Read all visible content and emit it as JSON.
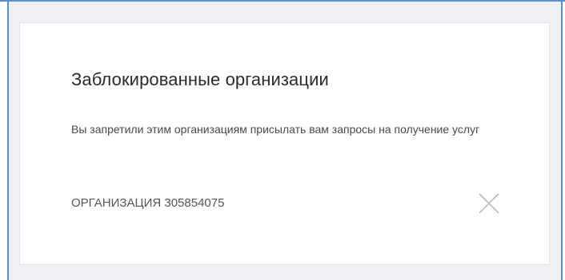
{
  "dialog": {
    "title": "Заблокированные организации",
    "description": "Вы запретили этим организациям присылать вам запросы на получение услуг"
  },
  "blocked_organizations": [
    {
      "name": "ОРГАНИЗАЦИЯ 305854075",
      "remove_icon": "close-icon"
    }
  ],
  "colors": {
    "frame_border": "#5b8fd0",
    "page_background": "#eef0f3",
    "card_background": "#ffffff",
    "title_text": "#2b2b2b",
    "body_text": "#4a4a4a",
    "icon": "#b8bcc2"
  }
}
